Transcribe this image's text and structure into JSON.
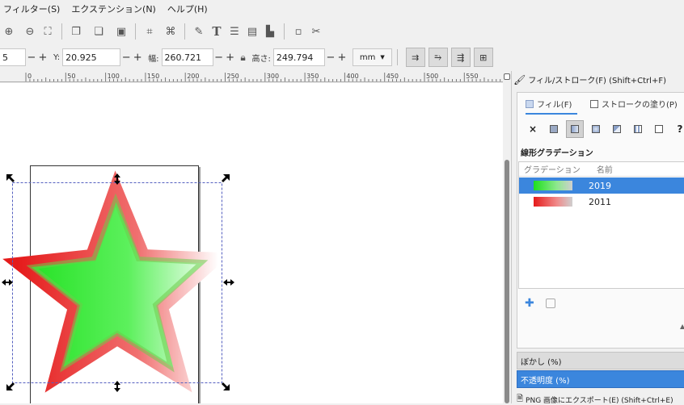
{
  "menu": {
    "items": [
      "フィルター(S)",
      "エクステンション(N)",
      "ヘルプ(H)"
    ]
  },
  "toolbar": {
    "x_value": "5",
    "y_label": "Y:",
    "y_value": "20.925",
    "w_label": "幅:",
    "w_value": "260.721",
    "h_label": "高さ:",
    "h_value": "249.794",
    "unit": "mm",
    "plus": "+",
    "minus": "−"
  },
  "ruler": {
    "labels": [
      "0",
      "50",
      "100",
      "150",
      "200",
      "250",
      "300",
      "350",
      "400",
      "450",
      "500",
      "550"
    ]
  },
  "panel": {
    "title": "フィル/ストローク(F) (Shift+Ctrl+F)",
    "tabs": {
      "fill": "フィル(F)",
      "stroke_paint": "ストロークの塗り(P)"
    },
    "fill_none_symbol": "×",
    "fill_unknown_symbol": "?",
    "gradient_heading": "線形グラデーション",
    "columns": {
      "gradient": "グラデーション",
      "name": "名前"
    },
    "gradients": [
      {
        "name": "2019",
        "color": "#21e021",
        "selected": true
      },
      {
        "name": "2011",
        "color": "#e01b1b",
        "selected": false
      }
    ],
    "blur_label": "ぼかし (%)",
    "opacity_label": "不透明度 (%)",
    "export_label": "PNG 画像にエクスポート(E) (Shift+Ctrl+E)"
  },
  "colors": {
    "selection_blue": "#3b86dd",
    "star_fill": "#21e021",
    "star_stroke": "#ee2222"
  }
}
